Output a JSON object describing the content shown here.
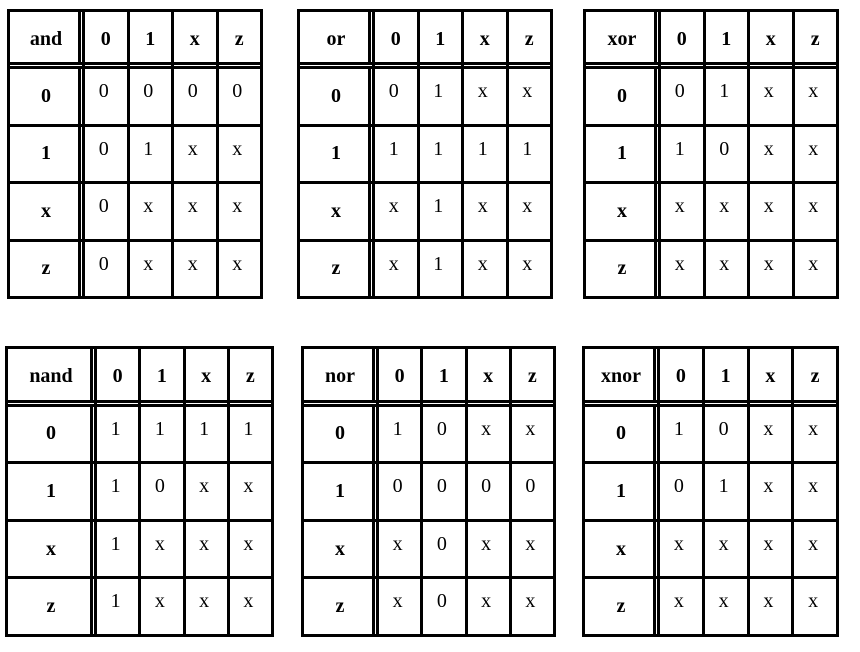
{
  "tables": [
    {
      "operator": "and",
      "columns": [
        "0",
        "1",
        "x",
        "z"
      ],
      "rows": [
        {
          "label": "0",
          "values": [
            "0",
            "0",
            "0",
            "0"
          ]
        },
        {
          "label": "1",
          "values": [
            "0",
            "1",
            "x",
            "x"
          ]
        },
        {
          "label": "x",
          "values": [
            "0",
            "x",
            "x",
            "x"
          ]
        },
        {
          "label": "z",
          "values": [
            "0",
            "x",
            "x",
            "x"
          ]
        }
      ]
    },
    {
      "operator": "or",
      "columns": [
        "0",
        "1",
        "x",
        "z"
      ],
      "rows": [
        {
          "label": "0",
          "values": [
            "0",
            "1",
            "x",
            "x"
          ]
        },
        {
          "label": "1",
          "values": [
            "1",
            "1",
            "1",
            "1"
          ]
        },
        {
          "label": "x",
          "values": [
            "x",
            "1",
            "x",
            "x"
          ]
        },
        {
          "label": "z",
          "values": [
            "x",
            "1",
            "x",
            "x"
          ]
        }
      ]
    },
    {
      "operator": "xor",
      "columns": [
        "0",
        "1",
        "x",
        "z"
      ],
      "rows": [
        {
          "label": "0",
          "values": [
            "0",
            "1",
            "x",
            "x"
          ]
        },
        {
          "label": "1",
          "values": [
            "1",
            "0",
            "x",
            "x"
          ]
        },
        {
          "label": "x",
          "values": [
            "x",
            "x",
            "x",
            "x"
          ]
        },
        {
          "label": "z",
          "values": [
            "x",
            "x",
            "x",
            "x"
          ]
        }
      ]
    },
    {
      "operator": "nand",
      "columns": [
        "0",
        "1",
        "x",
        "z"
      ],
      "rows": [
        {
          "label": "0",
          "values": [
            "1",
            "1",
            "1",
            "1"
          ]
        },
        {
          "label": "1",
          "values": [
            "1",
            "0",
            "x",
            "x"
          ]
        },
        {
          "label": "x",
          "values": [
            "1",
            "x",
            "x",
            "x"
          ]
        },
        {
          "label": "z",
          "values": [
            "1",
            "x",
            "x",
            "x"
          ]
        }
      ]
    },
    {
      "operator": "nor",
      "columns": [
        "0",
        "1",
        "x",
        "z"
      ],
      "rows": [
        {
          "label": "0",
          "values": [
            "1",
            "0",
            "x",
            "x"
          ]
        },
        {
          "label": "1",
          "values": [
            "0",
            "0",
            "0",
            "0"
          ]
        },
        {
          "label": "x",
          "values": [
            "x",
            "0",
            "x",
            "x"
          ]
        },
        {
          "label": "z",
          "values": [
            "x",
            "0",
            "x",
            "x"
          ]
        }
      ]
    },
    {
      "operator": "xnor",
      "columns": [
        "0",
        "1",
        "x",
        "z"
      ],
      "rows": [
        {
          "label": "0",
          "values": [
            "1",
            "0",
            "x",
            "x"
          ]
        },
        {
          "label": "1",
          "values": [
            "0",
            "1",
            "x",
            "x"
          ]
        },
        {
          "label": "x",
          "values": [
            "x",
            "x",
            "x",
            "x"
          ]
        },
        {
          "label": "z",
          "values": [
            "x",
            "x",
            "x",
            "x"
          ]
        }
      ]
    }
  ]
}
